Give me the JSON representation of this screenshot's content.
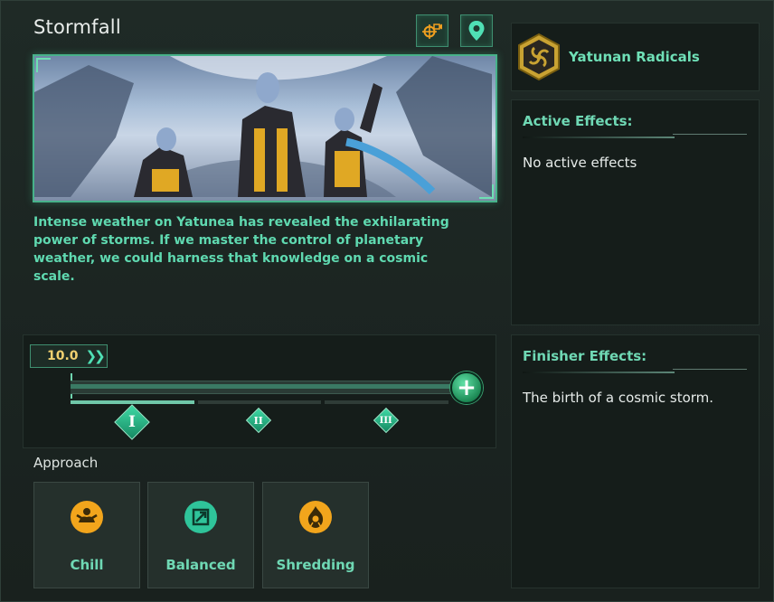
{
  "event": {
    "title": "Stormfall",
    "description": "Intense weather on Yatunea has revealed the exhilarating power of storms. If we master the control of planetary weather, we could harness that knowledge on a cosmic scale."
  },
  "toolbar": {
    "camera_icon": "camera-target-icon",
    "location_icon": "map-pin-icon"
  },
  "progress": {
    "speed": "10.0",
    "speed_icon": "fast-forward-icon",
    "stages": [
      "I",
      "II",
      "III"
    ],
    "active_stage_index": 0,
    "first_segment_fill": 1.0
  },
  "approach": {
    "label": "Approach",
    "options": [
      {
        "label": "Chill",
        "icon": "meditation-icon",
        "color": "#f2a51c"
      },
      {
        "label": "Balanced",
        "icon": "balance-icon",
        "color": "#2fc49a"
      },
      {
        "label": "Shredding",
        "icon": "fire-icon",
        "color": "#f2a51c"
      }
    ]
  },
  "faction": {
    "name": "Yatunan Radicals",
    "icon": "spiral-emblem-icon"
  },
  "active_effects": {
    "heading": "Active Effects:",
    "text": "No active effects"
  },
  "finisher_effects": {
    "heading": "Finisher Effects:",
    "text": "The birth of a cosmic storm."
  },
  "colors": {
    "accent": "#5fd9b0",
    "gold": "#f2a51c",
    "panel": "#151d1a"
  }
}
